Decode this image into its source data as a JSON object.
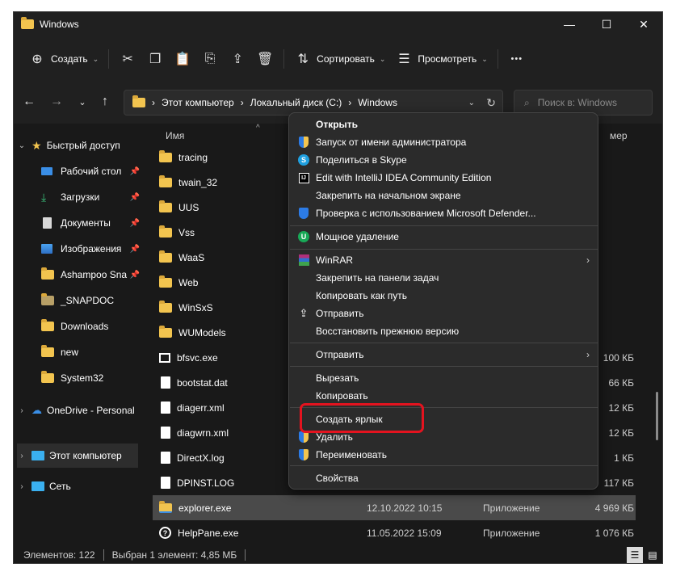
{
  "window": {
    "title": "Windows",
    "controls": [
      "—",
      "☐",
      "✕"
    ]
  },
  "toolbar": {
    "create_label": "Создать",
    "sort_label": "Сортировать",
    "view_label": "Просмотреть",
    "more_label": "•••"
  },
  "address": {
    "crumbs": [
      "Этот компьютер",
      "Локальный диск (C:)",
      "Windows"
    ],
    "search_placeholder": "Поиск в: Windows"
  },
  "sidebar": {
    "items": [
      {
        "label": "Быстрый доступ",
        "icon": "star-icon"
      },
      {
        "label": "Рабочий стол",
        "icon": "desktop-icon"
      },
      {
        "label": "Загрузки",
        "icon": "download-icon"
      },
      {
        "label": "Документы",
        "icon": "documents-icon"
      },
      {
        "label": "Изображения",
        "icon": "images-icon"
      },
      {
        "label": "Ashampoo Sna",
        "icon": "folder-icon"
      },
      {
        "label": "_SNAPDOC",
        "icon": "folder-icon"
      },
      {
        "label": "Downloads",
        "icon": "folder-icon"
      },
      {
        "label": "new",
        "icon": "folder-icon"
      },
      {
        "label": "System32",
        "icon": "folder-icon"
      },
      {
        "label": "OneDrive - Personal",
        "icon": "cloud-icon"
      },
      {
        "label": "Этот компьютер",
        "icon": "computer-icon"
      },
      {
        "label": "Сеть",
        "icon": "network-icon"
      }
    ]
  },
  "columns": {
    "name": "Имя",
    "size_partial": "мер"
  },
  "files": [
    {
      "name": "tracing",
      "kind": "folder",
      "date": "",
      "type": "",
      "size": ""
    },
    {
      "name": "twain_32",
      "kind": "folder",
      "date": "",
      "type": "",
      "size": ""
    },
    {
      "name": "UUS",
      "kind": "folder",
      "date": "",
      "type": "",
      "size": ""
    },
    {
      "name": "Vss",
      "kind": "folder",
      "date": "",
      "type": "",
      "size": ""
    },
    {
      "name": "WaaS",
      "kind": "folder",
      "date": "",
      "type": "",
      "size": ""
    },
    {
      "name": "Web",
      "kind": "folder",
      "date": "",
      "type": "",
      "size": ""
    },
    {
      "name": "WinSxS",
      "kind": "folder",
      "date": "",
      "type": "",
      "size": ""
    },
    {
      "name": "WUModels",
      "kind": "folder",
      "date": "",
      "type": "",
      "size": ""
    },
    {
      "name": "bfsvc.exe",
      "kind": "exe",
      "date": "",
      "type": "",
      "size": "100 КБ"
    },
    {
      "name": "bootstat.dat",
      "kind": "file",
      "date": "",
      "type": "",
      "size": "66 КБ"
    },
    {
      "name": "diagerr.xml",
      "kind": "file",
      "date": "",
      "type": "",
      "size": "12 КБ"
    },
    {
      "name": "diagwrn.xml",
      "kind": "file",
      "date": "",
      "type": "",
      "size": "12 КБ"
    },
    {
      "name": "DirectX.log",
      "kind": "file",
      "date": "",
      "type": "",
      "size": "1 КБ"
    },
    {
      "name": "DPINST.LOG",
      "kind": "file",
      "date": "",
      "type": "",
      "size": "117 КБ"
    },
    {
      "name": "explorer.exe",
      "kind": "explorer",
      "date": "12.10.2022 10:15",
      "type": "Приложение",
      "size": "4 969 КБ"
    },
    {
      "name": "HelpPane.exe",
      "kind": "help",
      "date": "11.05.2022 15:09",
      "type": "Приложение",
      "size": "1 076 КБ"
    }
  ],
  "context_menu": {
    "items": [
      {
        "label": "Открыть",
        "bold": true
      },
      {
        "label": "Запуск от имени администратора",
        "icon": "shield-icon"
      },
      {
        "label": "Поделиться в Skype",
        "icon": "skype-icon"
      },
      {
        "label": "Edit with IntelliJ IDEA Community Edition",
        "icon": "intellij-icon"
      },
      {
        "label": "Закрепить на начальном экране"
      },
      {
        "label": "Проверка с использованием Microsoft Defender...",
        "icon": "defender-icon"
      },
      {
        "label": "Мощное удаление",
        "icon": "uninstall-icon"
      },
      {
        "label": "WinRAR",
        "icon": "winrar-icon",
        "submenu": true
      },
      {
        "label": "Закрепить на панели задач"
      },
      {
        "label": "Копировать как путь"
      },
      {
        "label": "Отправить",
        "icon": "share-icon"
      },
      {
        "label": "Восстановить прежнюю версию"
      },
      {
        "label": "Отправить",
        "submenu": true
      },
      {
        "label": "Вырезать"
      },
      {
        "label": "Копировать"
      },
      {
        "label": "Создать ярлык"
      },
      {
        "label": "Удалить",
        "icon": "shield-icon"
      },
      {
        "label": "Переименовать",
        "icon": "shield-icon"
      },
      {
        "label": "Свойства"
      }
    ]
  },
  "status": {
    "count": "Элементов: 122",
    "selection": "Выбран 1 элемент: 4,85 МБ"
  },
  "colors": {
    "background": "#191919",
    "highlight": "#e4131f",
    "folder": "#f2c44f"
  }
}
